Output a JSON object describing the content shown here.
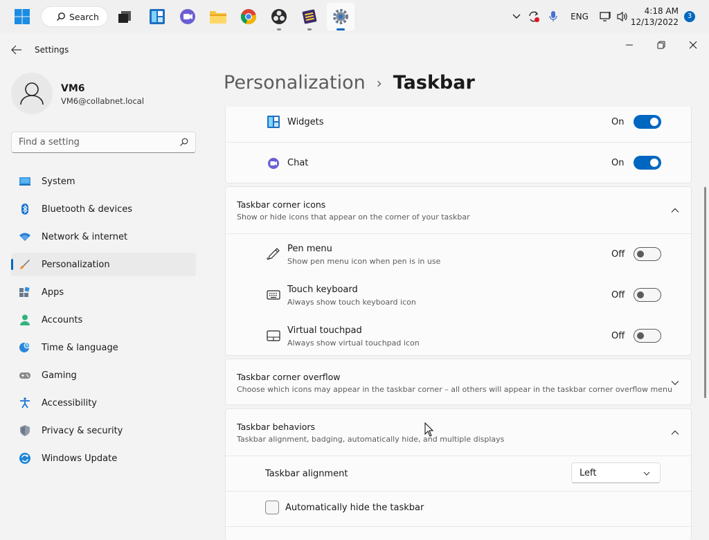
{
  "taskbar": {
    "search_label": "Search",
    "language": "ENG",
    "time": "4:18 AM",
    "date": "12/13/2022",
    "notification_count": "3"
  },
  "window": {
    "title": "Settings"
  },
  "user": {
    "name": "VM6",
    "email": "VM6@collabnet.local"
  },
  "search": {
    "placeholder": "Find a setting"
  },
  "sidebar": {
    "items": [
      {
        "label": "System",
        "icon": "monitor-icon"
      },
      {
        "label": "Bluetooth & devices",
        "icon": "bluetooth-icon"
      },
      {
        "label": "Network & internet",
        "icon": "wifi-icon"
      },
      {
        "label": "Personalization",
        "icon": "brush-icon",
        "selected": true
      },
      {
        "label": "Apps",
        "icon": "apps-icon"
      },
      {
        "label": "Accounts",
        "icon": "person-icon"
      },
      {
        "label": "Time & language",
        "icon": "globe-clock-icon"
      },
      {
        "label": "Gaming",
        "icon": "gamepad-icon"
      },
      {
        "label": "Accessibility",
        "icon": "accessibility-icon"
      },
      {
        "label": "Privacy & security",
        "icon": "shield-icon"
      },
      {
        "label": "Windows Update",
        "icon": "update-icon"
      }
    ]
  },
  "breadcrumb": {
    "parent": "Personalization",
    "separator": "›",
    "current": "Taskbar"
  },
  "taskbar_items": {
    "widgets": {
      "label": "Widgets",
      "state": "On",
      "on": true
    },
    "chat": {
      "label": "Chat",
      "state": "On",
      "on": true
    }
  },
  "corner_icons": {
    "title": "Taskbar corner icons",
    "subtitle": "Show or hide icons that appear on the corner of your taskbar",
    "items": [
      {
        "title": "Pen menu",
        "subtitle": "Show pen menu icon when pen is in use",
        "state": "Off",
        "icon": "pen-icon"
      },
      {
        "title": "Touch keyboard",
        "subtitle": "Always show touch keyboard icon",
        "state": "Off",
        "icon": "keyboard-icon"
      },
      {
        "title": "Virtual touchpad",
        "subtitle": "Always show virtual touchpad icon",
        "state": "Off",
        "icon": "touchpad-icon"
      }
    ]
  },
  "corner_overflow": {
    "title": "Taskbar corner overflow",
    "subtitle": "Choose which icons may appear in the taskbar corner – all others will appear in the taskbar corner overflow menu"
  },
  "behaviors": {
    "title": "Taskbar behaviors",
    "subtitle": "Taskbar alignment, badging, automatically hide, and multiple displays",
    "alignment_label": "Taskbar alignment",
    "alignment_value": "Left",
    "autohide_label": "Automatically hide the taskbar",
    "autohide_checked": false
  },
  "colors": {
    "accent": "#0067c0"
  }
}
